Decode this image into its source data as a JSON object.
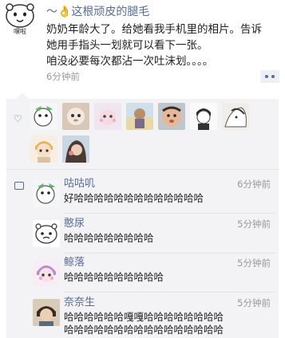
{
  "post": {
    "author": "～👌这根顽皮的腿毛",
    "text_lines": [
      "奶奶年龄大了。给她看我手机里的相片。告诉",
      "她用手指头一划就可以看下一张。",
      "咱没必要每次都沾一次吐沫划。。。。"
    ],
    "time": "6分钟前",
    "avatar": {
      "caption": "嘿啦",
      "icon": "meme-bear-icon"
    }
  },
  "likes": {
    "icon": "heart-icon",
    "avatars": [
      "avatar-1",
      "avatar-2",
      "avatar-3",
      "avatar-4",
      "avatar-5",
      "avatar-6",
      "avatar-7",
      "avatar-8",
      "avatar-9"
    ]
  },
  "comments": [
    {
      "name": "咕咕叽",
      "time": "6分钟前",
      "lines": [
        "好哈哈哈哈哈哈哈哈哈哈哈哈哈"
      ]
    },
    {
      "name": "憨尿",
      "time": "5分钟前",
      "lines": [
        "哈哈哈哈哈哈哈哈哈"
      ]
    },
    {
      "name": "鲸落",
      "time": "5分钟前",
      "lines": [
        "哈哈哈哈哈哈哈哈哈哈"
      ]
    },
    {
      "name": "奈奈生",
      "time": "5分钟前",
      "lines": [
        "哈哈哈哈哈哈嘎嘎哈哈哈哈哈哈哈哈",
        "哈哈哈哈哈哈哈哈哈哈哈哈哈哈哈哈"
      ]
    }
  ],
  "colors": {
    "link": "#576b95",
    "panel": "#f3f3f5",
    "time": "#999999"
  }
}
